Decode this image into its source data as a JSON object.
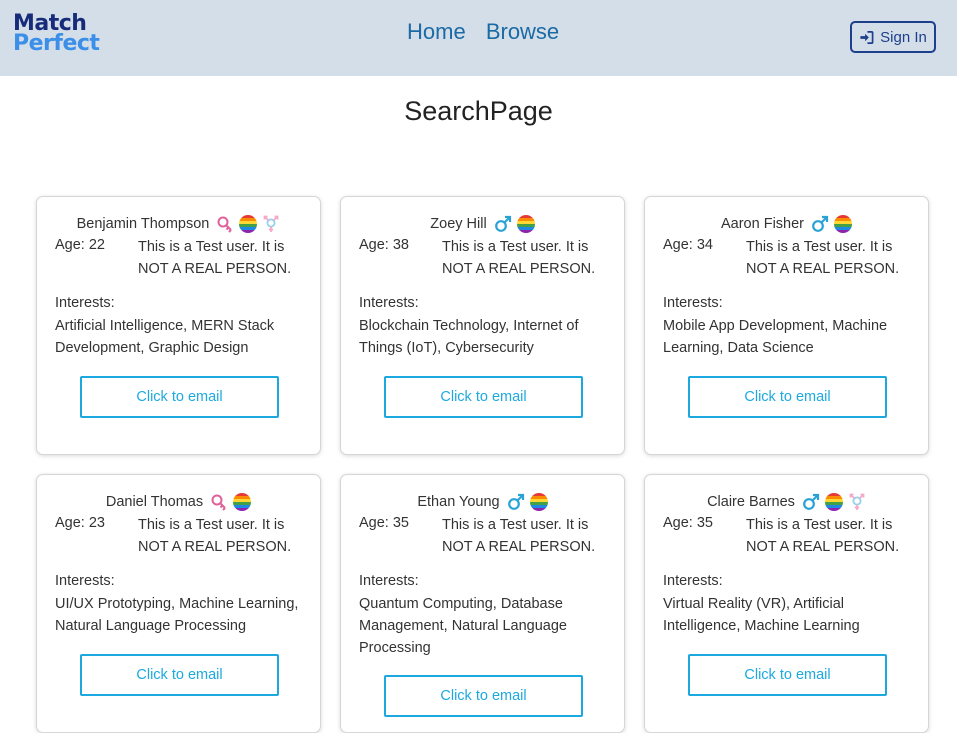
{
  "nav": {
    "logo_line1": "Match",
    "logo_line2": "Perfect",
    "home": "Home",
    "browse": "Browse",
    "signin": "Sign In"
  },
  "page": {
    "title": "SearchPage"
  },
  "colors": {
    "navbar": "#d3dee8",
    "accent": "#1ca9e0",
    "link": "#1b6aa5"
  },
  "users": [
    {
      "name": "Benjamin Thompson",
      "age": "Age: 22",
      "desc": "This is a Test user. It is NOT A REAL PERSON.",
      "interests_label": "Interests:",
      "interests": "Artificial Intelligence, MERN Stack Development, Graphic Design",
      "button": "Click to email",
      "icons": [
        "female-icon",
        "rainbow-icon",
        "transgender-icon"
      ]
    },
    {
      "name": "Zoey Hill",
      "age": "Age: 38",
      "desc": "This is a Test user. It is NOT A REAL PERSON.",
      "interests_label": "Interests:",
      "interests": "Blockchain Technology, Internet of Things (IoT), Cybersecurity",
      "button": "Click to email",
      "icons": [
        "male-icon",
        "rainbow-icon"
      ]
    },
    {
      "name": "Aaron Fisher",
      "age": "Age: 34",
      "desc": "This is a Test user. It is NOT A REAL PERSON.",
      "interests_label": "Interests:",
      "interests": "Mobile App Development, Machine Learning, Data Science",
      "button": "Click to email",
      "icons": [
        "male-icon",
        "rainbow-icon"
      ]
    },
    {
      "name": "Daniel Thomas",
      "age": "Age: 23",
      "desc": "This is a Test user. It is NOT A REAL PERSON.",
      "interests_label": "Interests:",
      "interests": "UI/UX Prototyping, Machine Learning, Natural Language Processing",
      "button": "Click to email",
      "icons": [
        "female-icon",
        "rainbow-icon"
      ]
    },
    {
      "name": "Ethan Young",
      "age": "Age: 35",
      "desc": "This is a Test user. It is NOT A REAL PERSON.",
      "interests_label": "Interests:",
      "interests": "Quantum Computing, Database Management, Natural Language Processing",
      "button": "Click to email",
      "icons": [
        "male-icon",
        "rainbow-icon"
      ]
    },
    {
      "name": "Claire Barnes",
      "age": "Age: 35",
      "desc": "This is a Test user. It is NOT A REAL PERSON.",
      "interests_label": "Interests:",
      "interests": "Virtual Reality (VR), Artificial Intelligence, Machine Learning",
      "button": "Click to email",
      "icons": [
        "male-icon",
        "rainbow-icon",
        "transgender-icon"
      ]
    }
  ]
}
